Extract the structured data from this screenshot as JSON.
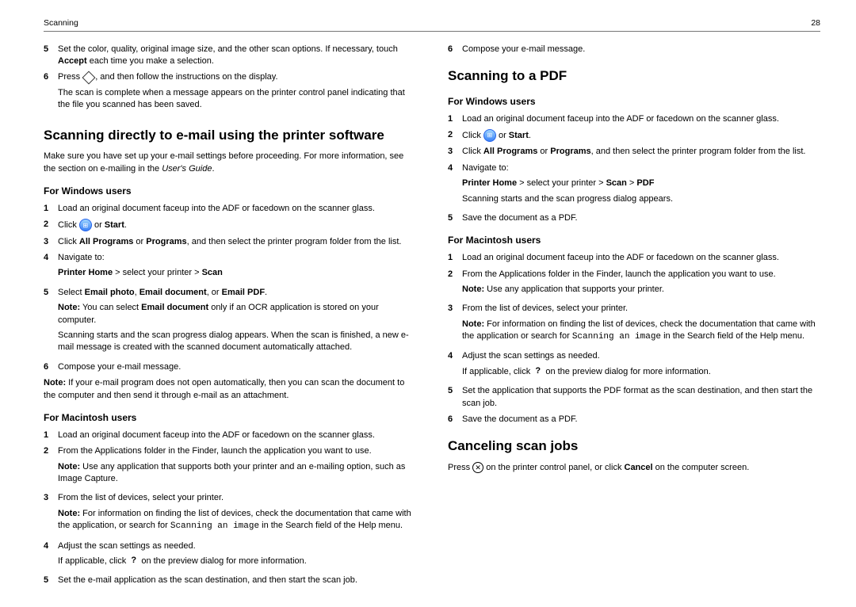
{
  "header": {
    "left": "Scanning",
    "right": "28"
  },
  "left": {
    "step5": {
      "n": "5",
      "pre": "Set the color, quality, original image size, and the other scan options. If necessary, touch ",
      "accept": "Accept",
      "post": " each time you make a selection."
    },
    "step6": {
      "n": "6",
      "press": "Press ",
      "follow": ", and then follow the instructions on the display.",
      "complete": "The scan is complete when a message appears on the printer control panel indicating that the file you scanned has been saved."
    },
    "h2a": "Scanning directly to e-mail using the printer software",
    "intro1": "Make sure you have set up your e-mail settings before proceeding. For more information, see the section on e-mailing in the ",
    "intro2": "User's Guide",
    "intro3": ".",
    "win": {
      "h": "For Windows users",
      "s1": {
        "n": "1",
        "t": "Load an original document faceup into the ADF or facedown on the scanner glass."
      },
      "s2": {
        "n": "2",
        "pre": "Click ",
        "or": " or ",
        "start": "Start",
        "post": "."
      },
      "s3": {
        "n": "3",
        "pre": "Click ",
        "ap": "All Programs",
        "or": " or ",
        "p": "Programs",
        "post": ", and then select the printer program folder from the list."
      },
      "s4": {
        "n": "4",
        "t": "Navigate to:",
        "ph": "Printer Home",
        "gt1": " > select your printer > ",
        "scan": "Scan"
      },
      "s5": {
        "n": "5",
        "pre": "Select ",
        "ep": "Email photo",
        "c1": ", ",
        "ed": "Email document",
        "c2": ", or ",
        "epdf": "Email PDF",
        "post": ".",
        "noteLabel": "Note:",
        "noteA": " You can select ",
        "noteB": "Email document",
        "noteC": " only if an OCR application is stored on your computer.",
        "after": "Scanning starts and the scan progress dialog appears. When the scan is finished, a new e-mail message is created with the scanned document automatically attached."
      },
      "s6": {
        "n": "6",
        "t": "Compose your e-mail message."
      },
      "note2Label": "Note:",
      "note2": " If your e-mail program does not open automatically, then you can scan the document to the computer and then send it through e-mail as an attachment."
    },
    "mac": {
      "h": "For Macintosh users",
      "s1": {
        "n": "1",
        "t": "Load an original document faceup into the ADF or facedown on the scanner glass."
      },
      "s2": {
        "n": "2",
        "t": "From the Applications folder in the Finder, launch the application you want to use.",
        "noteLabel": "Note:",
        "noteT": " Use any application that supports both your printer and an e-mailing option, such as Image Capture."
      },
      "s3": {
        "n": "3",
        "t": "From the list of devices, select your printer.",
        "noteLabel": "Note:",
        "noteA": " For information on finding the list of devices, check the documentation that came with the application, or search for ",
        "code": "Scanning an image",
        "noteB": " in the Search field of the Help menu."
      },
      "s4": {
        "n": "4",
        "t": "Adjust the scan settings as needed.",
        "if": "If applicable, click ",
        "rest": " on the preview dialog for more information."
      },
      "s5": {
        "n": "5",
        "t": "Set the e-mail application as the scan destination, and then start the scan job."
      }
    }
  },
  "right": {
    "s6top": {
      "n": "6",
      "t": "Compose your e-mail message."
    },
    "h2a": "Scanning to a PDF",
    "win": {
      "h": "For Windows users",
      "s1": {
        "n": "1",
        "t": "Load an original document faceup into the ADF or facedown on the scanner glass."
      },
      "s2": {
        "n": "2",
        "pre": "Click ",
        "or": " or ",
        "start": "Start",
        "post": "."
      },
      "s3": {
        "n": "3",
        "pre": "Click ",
        "ap": "All Programs",
        "or": " or ",
        "p": "Programs",
        "post": ", and then select the printer program folder from the list."
      },
      "s4": {
        "n": "4",
        "t": "Navigate to:",
        "ph": "Printer Home",
        "gt1": " > select your printer > ",
        "scan": "Scan",
        "gt2": " > ",
        "pdf": "PDF",
        "after": "Scanning starts and the scan progress dialog appears."
      },
      "s5": {
        "n": "5",
        "t": "Save the document as a PDF."
      }
    },
    "mac": {
      "h": "For Macintosh users",
      "s1": {
        "n": "1",
        "t": "Load an original document faceup into the ADF or facedown on the scanner glass."
      },
      "s2": {
        "n": "2",
        "t": "From the Applications folder in the Finder, launch the application you want to use.",
        "noteLabel": "Note:",
        "noteT": " Use any application that supports your printer."
      },
      "s3": {
        "n": "3",
        "t": "From the list of devices, select your printer.",
        "noteLabel": "Note:",
        "noteA": " For information on finding the list of devices, check the documentation that came with the application or search for ",
        "code": "Scanning an image",
        "noteB": " in the Search field of the Help menu."
      },
      "s4": {
        "n": "4",
        "t": "Adjust the scan settings as needed.",
        "if": "If applicable, click ",
        "rest": " on the preview dialog for more information."
      },
      "s5": {
        "n": "5",
        "t": "Set the application that supports the PDF format as the scan destination, and then start the scan job."
      },
      "s6": {
        "n": "6",
        "t": "Save the document as a PDF."
      }
    },
    "h2b": "Canceling scan jobs",
    "cancel": {
      "press": "Press ",
      "mid": " on the printer control panel, or click ",
      "cancel": "Cancel",
      "post": " on the computer screen."
    }
  }
}
